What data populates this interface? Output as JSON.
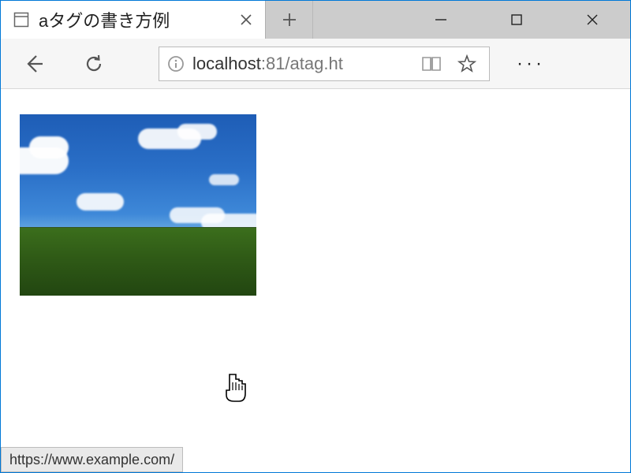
{
  "tab": {
    "title": "aタグの書き方例"
  },
  "address": {
    "prefix": "localhost",
    "rest": ":81/atag.ht"
  },
  "status": {
    "url": "https://www.example.com/"
  }
}
